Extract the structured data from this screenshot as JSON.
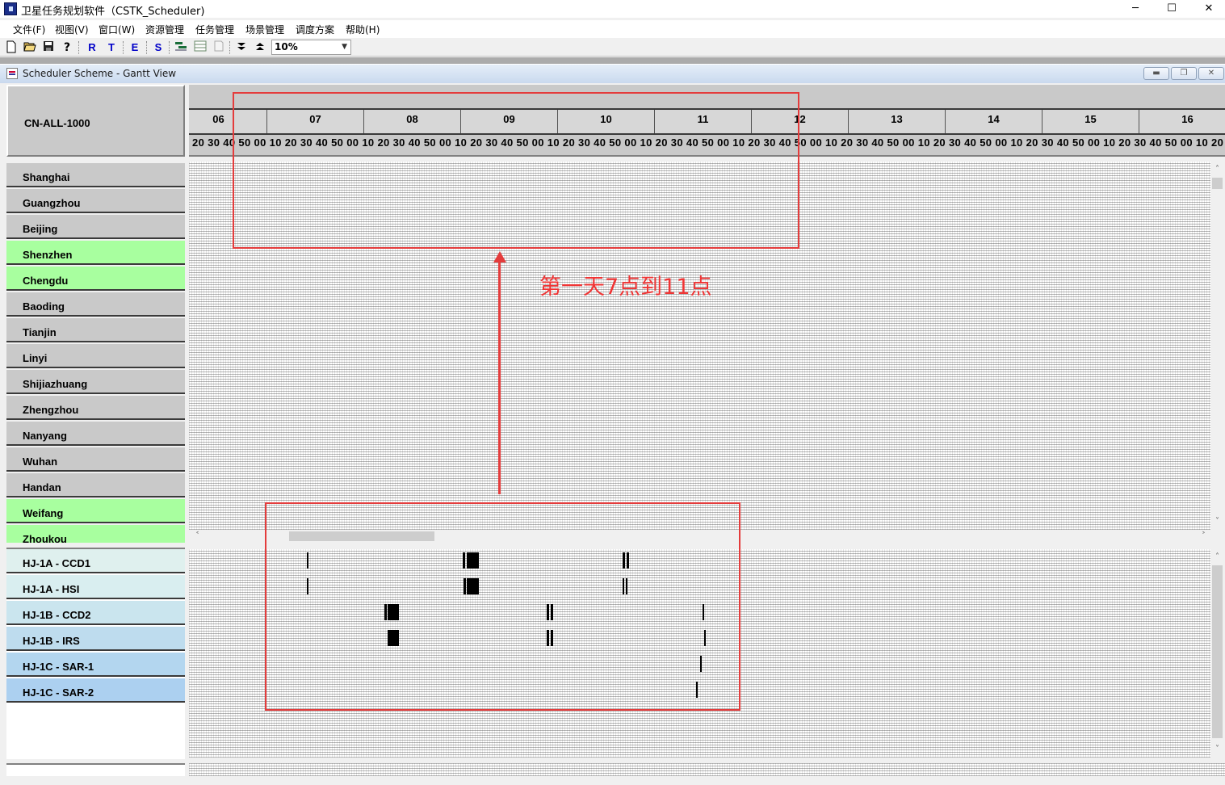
{
  "window": {
    "title": "卫星任务规划软件（CSTK_Scheduler)",
    "minimize": "─",
    "maximize": "☐",
    "close": "✕"
  },
  "menu": [
    "文件(F)",
    "视图(V)",
    "窗口(W)",
    "资源管理",
    "任务管理",
    "场景管理",
    "调度方案",
    "帮助(H)"
  ],
  "toolbar": {
    "buttons": [
      "new-icon",
      "open-icon",
      "save-icon",
      "help-icon",
      "R",
      "T",
      "E",
      "S",
      "gantt-icon",
      "table-icon",
      "print-icon",
      "collapse-icon",
      "expand-icon"
    ],
    "letters": [
      "R",
      "T",
      "E",
      "S"
    ],
    "zoom": "10%"
  },
  "child_window": {
    "title": "Scheduler Scheme - Gantt View",
    "buttons": [
      "minimize",
      "restore",
      "close"
    ]
  },
  "scheme": "CN-ALL-1000",
  "colors": {
    "normal_row": "#c9c9c9",
    "highlight_row": "#a8ff9f",
    "sat_rows": [
      "#dff0ee",
      "#d9eef0",
      "#cae5ee",
      "#bedcee",
      "#b3d6ef",
      "#acd0f0"
    ],
    "annotation": "#e43c3c"
  },
  "resources": [
    {
      "name": "Shanghai",
      "highlight": false
    },
    {
      "name": "Guangzhou",
      "highlight": false
    },
    {
      "name": "Beijing",
      "highlight": false
    },
    {
      "name": "Shenzhen",
      "highlight": true
    },
    {
      "name": "Chengdu",
      "highlight": true
    },
    {
      "name": "Baoding",
      "highlight": false
    },
    {
      "name": "Tianjin",
      "highlight": false
    },
    {
      "name": "Linyi",
      "highlight": false
    },
    {
      "name": "Shijiazhuang",
      "highlight": false
    },
    {
      "name": "Zhengzhou",
      "highlight": false
    },
    {
      "name": "Nanyang",
      "highlight": false
    },
    {
      "name": "Wuhan",
      "highlight": false
    },
    {
      "name": "Handan",
      "highlight": false
    },
    {
      "name": "Weifang",
      "highlight": true
    },
    {
      "name": "Zhoukou",
      "highlight": true
    }
  ],
  "satellites": [
    "HJ-1A - CCD1",
    "HJ-1A - HSI",
    "HJ-1B - CCD2",
    "HJ-1B - IRS",
    "HJ-1C - SAR-1",
    "HJ-1C - SAR-2"
  ],
  "timeline": {
    "hours": [
      "06",
      "07",
      "08",
      "09",
      "10",
      "11",
      "12",
      "13",
      "14",
      "15",
      "16"
    ],
    "minute_ticks": "20 30 40 50 00 10 20 30 40 50 00 10 20 30 40 50 00 10 20 30 40 50 00 10 20 30 40 50 00 10 20 30 40 50 00 10 20 30 40 50 00 10 20 30 40 50 00 10 20 30 40 50 00 10 20 30 40 50 00 10 20 30 40 50 00 10 20 30 40 50"
  },
  "annotation": {
    "text": "第一天7点到11点"
  }
}
